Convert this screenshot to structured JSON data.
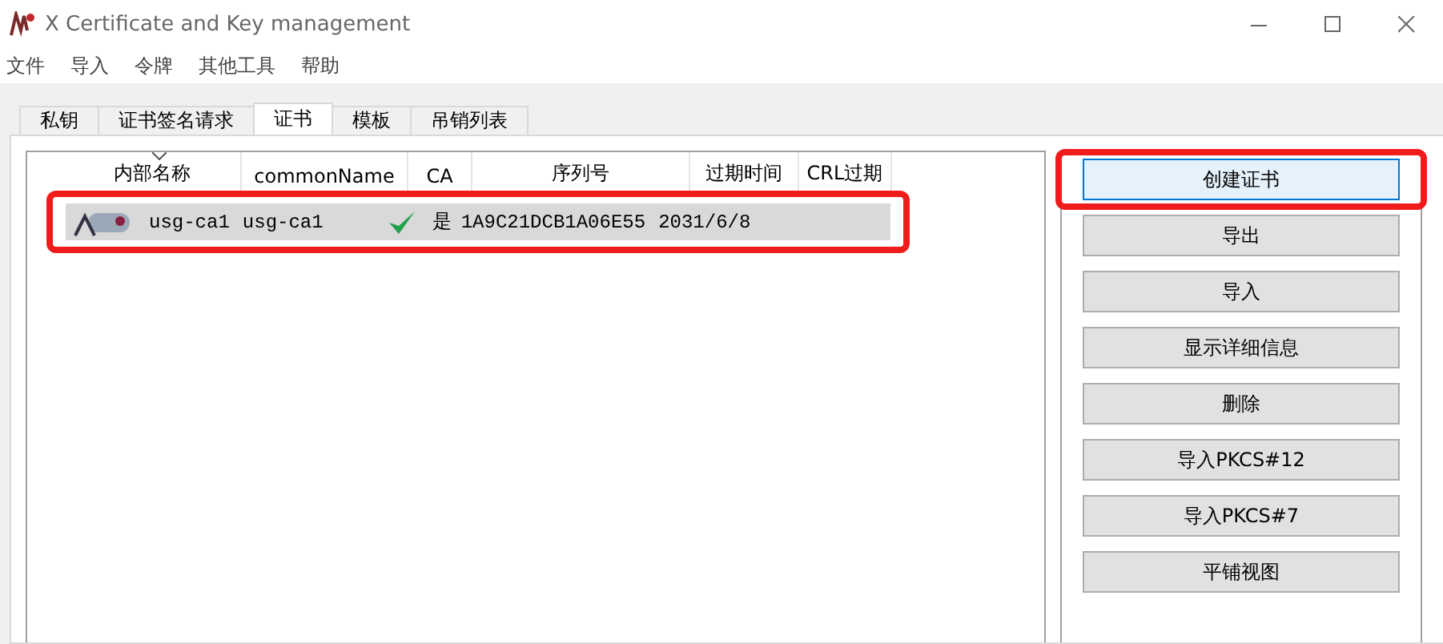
{
  "window": {
    "title": "X Certificate and Key management"
  },
  "menu": [
    "文件",
    "导入",
    "令牌",
    "其他工具",
    "帮助"
  ],
  "tabs": [
    {
      "label": "私钥",
      "selected": false
    },
    {
      "label": "证书签名请求",
      "selected": false
    },
    {
      "label": "证书",
      "selected": true
    },
    {
      "label": "模板",
      "selected": false
    },
    {
      "label": "吊销列表",
      "selected": false
    }
  ],
  "table": {
    "columns": [
      "内部名称",
      "commonName",
      "CA",
      "序列号",
      "过期时间",
      "CRL过期"
    ],
    "rows": [
      {
        "internal_name": "usg-ca1",
        "common_name": "usg-ca1",
        "ca_checked": true,
        "ca": "是",
        "serial": "1A9C21DCB1A06E55",
        "expiry": "2031/6/8",
        "selected": true,
        "highlighted": true
      }
    ]
  },
  "buttons": [
    {
      "label": "创建证书",
      "focused": true,
      "highlighted": true
    },
    {
      "label": "导出",
      "focused": false,
      "highlighted": false
    },
    {
      "label": "导入",
      "focused": false,
      "highlighted": false
    },
    {
      "label": "显示详细信息",
      "focused": false,
      "highlighted": false
    },
    {
      "label": "删除",
      "focused": false,
      "highlighted": false
    },
    {
      "label": "导入PKCS#12",
      "focused": false,
      "highlighted": false
    },
    {
      "label": "导入PKCS#7",
      "focused": false,
      "highlighted": false
    },
    {
      "label": "平铺视图",
      "focused": false,
      "highlighted": false
    }
  ]
}
